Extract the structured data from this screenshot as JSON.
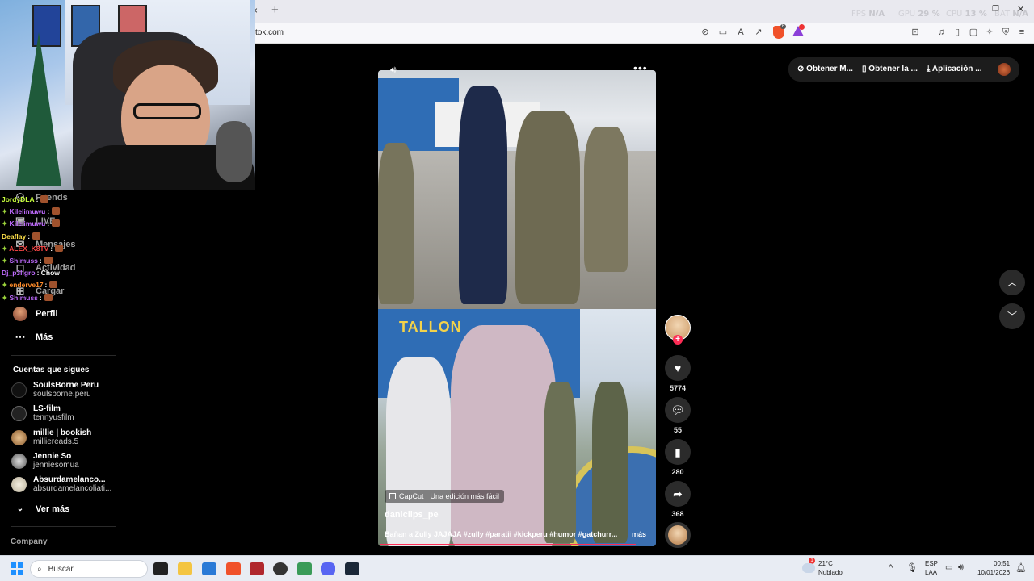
{
  "browser": {
    "url": "tok.com",
    "new_tab_glyph": "+",
    "tab_close_glyph": "×",
    "hud": {
      "fps_label": "FPS",
      "fps_value": "N/A",
      "gpu_label": "GPU",
      "gpu_value": "29 %",
      "cpu_label": "CPU",
      "cpu_value": "13 %",
      "bat_label": "BAT",
      "bat_value": "N/A"
    },
    "window_controls": [
      "–",
      "❐",
      "✕"
    ]
  },
  "left_nav": {
    "items": [
      {
        "label": "Friends",
        "icon": "friends-icon"
      },
      {
        "label": "LIVE",
        "icon": "live-icon"
      },
      {
        "label": "Mensajes",
        "icon": "messages-icon"
      },
      {
        "label": "Actividad",
        "icon": "activity-icon"
      },
      {
        "label": "Cargar",
        "icon": "upload-icon"
      },
      {
        "label": "Perfil",
        "icon": "profile-avatar"
      },
      {
        "label": "Más",
        "icon": "more-icon"
      }
    ],
    "following_title": "Cuentas que sigues",
    "following": [
      {
        "name": "SoulsBorne Peru",
        "handle": "soulsborne.peru"
      },
      {
        "name": "LS-film",
        "handle": "tennyusfilm"
      },
      {
        "name": "millie | bookish",
        "handle": "milliereads.5"
      },
      {
        "name": "Jennie So",
        "handle": "jenniesomua"
      },
      {
        "name": "Absurdamelanco...",
        "handle": "absurdamelancoliati..."
      }
    ],
    "see_more": "Ver más",
    "company": "Company"
  },
  "chat": [
    {
      "user": "JordyDLA",
      "color": "#c8ff3c",
      "msg": ":",
      "emote": true,
      "badge": false
    },
    {
      "user": "Kilelimuwu",
      "color": "#c06bff",
      "msg": ":",
      "emote": true,
      "badge": true
    },
    {
      "user": "Kilelimuwu",
      "color": "#c06bff",
      "msg": ":",
      "emote": true,
      "badge": true
    },
    {
      "user": "Deaflay",
      "color": "#ffe14a",
      "msg": ":",
      "emote": true,
      "badge": false
    },
    {
      "user": "ALEX_K8TV",
      "color": "#ff4848",
      "msg": ":",
      "emote": true,
      "badge": true
    },
    {
      "user": "Shimuss",
      "color": "#c06bff",
      "msg": ":",
      "emote": true,
      "badge": true
    },
    {
      "user": "Dj_p3ligro",
      "color": "#c06bff",
      "msg": ": Chow",
      "emote": false,
      "badge": false
    },
    {
      "user": "enderve17",
      "color": "#ff8c2a",
      "msg": ":",
      "emote": true,
      "badge": true
    },
    {
      "user": "Shimuss",
      "color": "#c06bff",
      "msg": ":",
      "emote": true,
      "badge": true
    }
  ],
  "video": {
    "banner_text": "TALLON",
    "capcut_label": "CapCut · Una edición más fácil",
    "author": "daniclips_pe",
    "description": "Bañan a Zully JAJAJA #zully #paratii #kickperu #humor #gatchurr...",
    "more": "más",
    "progress": 0.96
  },
  "actions": {
    "likes": "5774",
    "comments": "55",
    "saves": "280",
    "shares": "368"
  },
  "top_pills": [
    "Obtener M...",
    "Obtener la ...",
    "Aplicación ..."
  ],
  "taskbar": {
    "search_placeholder": "Buscar",
    "weather_temp": "21°C",
    "weather_desc": "Nublado",
    "weather_badge": "1",
    "lang_top": "ESP",
    "lang_bottom": "LAA",
    "time": "00:51",
    "date": "10/01/2026"
  },
  "colors": {
    "accent": "#fe2c55",
    "taskbar_bg": "#e8ecf3"
  }
}
